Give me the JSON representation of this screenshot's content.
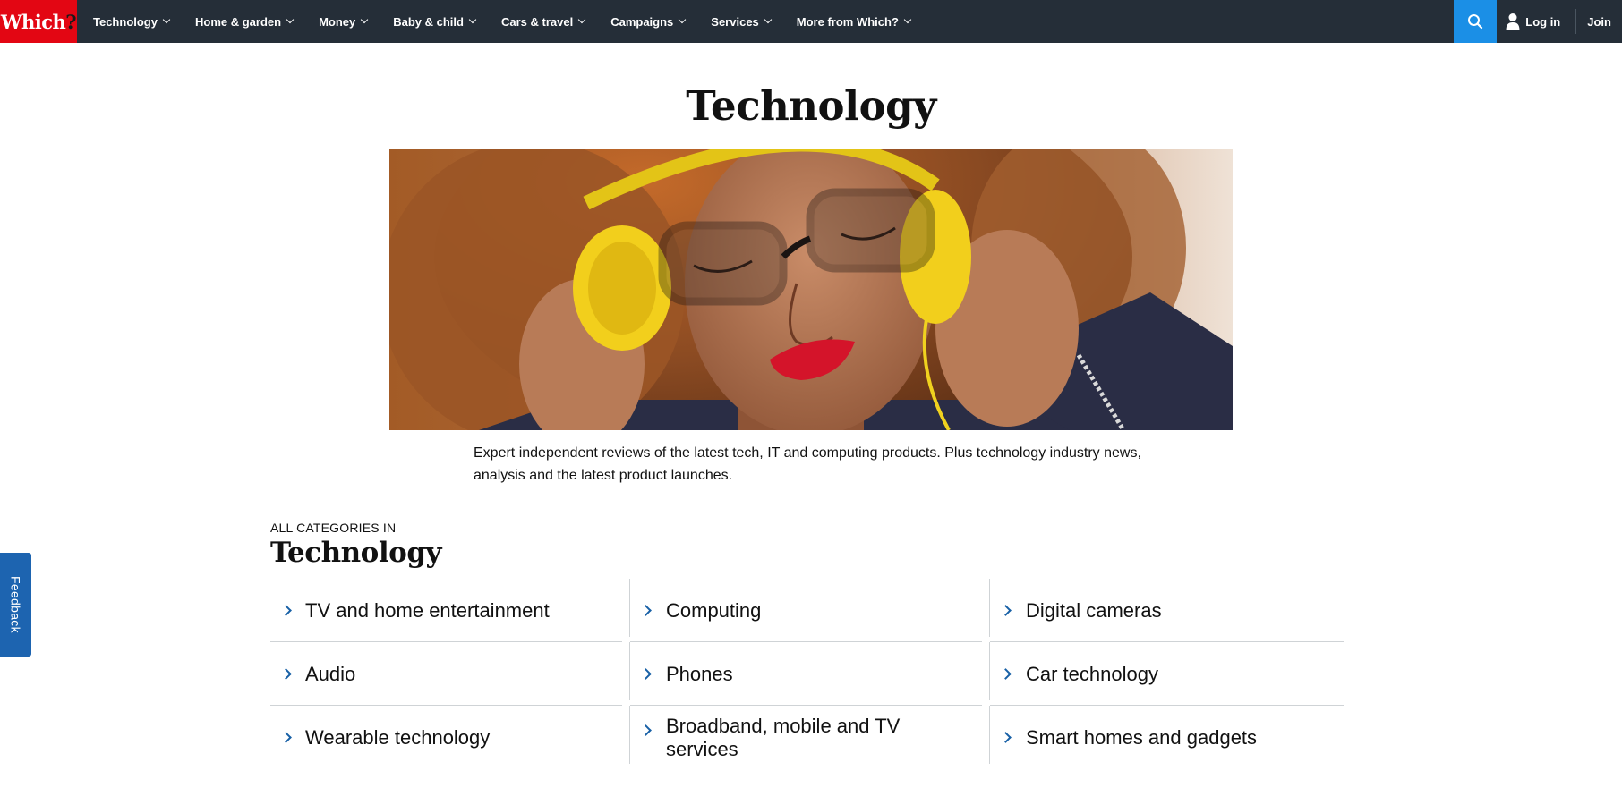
{
  "brand": {
    "logo_text": "Which",
    "logo_mark": "?",
    "accent_color": "#e30613",
    "nav_bg": "#252e38",
    "search_color": "#1b8fe6"
  },
  "nav": {
    "items": [
      {
        "label": "Technology"
      },
      {
        "label": "Home & garden"
      },
      {
        "label": "Money"
      },
      {
        "label": "Baby & child"
      },
      {
        "label": "Cars & travel"
      },
      {
        "label": "Campaigns"
      },
      {
        "label": "Services"
      },
      {
        "label": "More from Which?"
      }
    ],
    "search_icon": "search-icon",
    "login_label": "Log in",
    "join_label": "Join"
  },
  "page": {
    "title": "Technology",
    "hero_image": "woman-with-yellow-headphones",
    "intro": "Expert independent reviews of the latest tech, IT and computing products. Plus technology industry news, analysis and the latest product launches."
  },
  "categories": {
    "kicker": "ALL CATEGORIES IN",
    "heading": "Technology",
    "items": [
      {
        "label": "TV and home entertainment"
      },
      {
        "label": "Computing"
      },
      {
        "label": "Digital cameras"
      },
      {
        "label": "Audio"
      },
      {
        "label": "Phones"
      },
      {
        "label": "Car technology"
      },
      {
        "label": "Wearable technology"
      },
      {
        "label": "Broadband, mobile and TV services"
      },
      {
        "label": "Smart homes and gadgets"
      }
    ]
  },
  "feedback": {
    "label": "Feedback",
    "color": "#1d64b0"
  }
}
